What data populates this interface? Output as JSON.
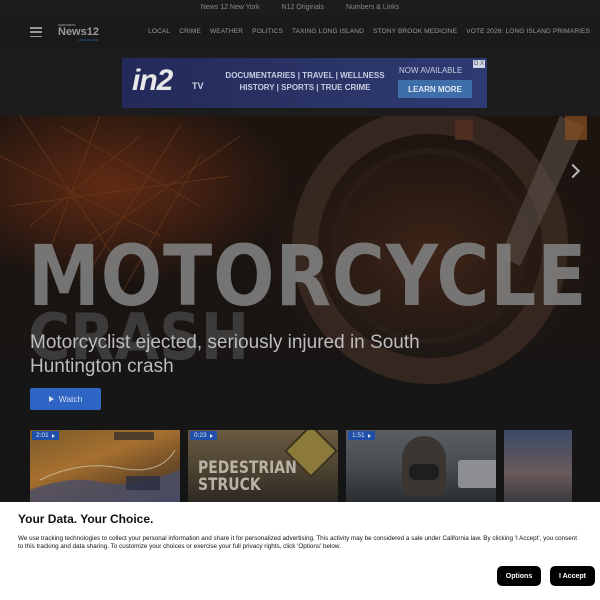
{
  "topbar": {
    "links": [
      "News 12 New York",
      "N12 Originals",
      "Numbers & Links"
    ]
  },
  "header": {
    "logo": {
      "prefix": "optimum.",
      "name": "News12",
      "sub": "LONG ISLAND"
    },
    "nav": [
      "LOCAL",
      "CRIME",
      "WEATHER",
      "POLITICS",
      "TAXING LONG ISLAND",
      "STONY BROOK MEDICINE",
      "VOTE 2026: LONG ISLAND PRIMARIES"
    ]
  },
  "ad": {
    "logo": "in2",
    "logo_suffix": "TV",
    "line1": "DOCUMENTARIES | TRAVEL | WELLNESS",
    "line2": "HISTORY | SPORTS | TRUE CRIME",
    "available": "NOW AVAILABLE",
    "cta": "LEARN MORE",
    "close": "D X"
  },
  "hero": {
    "graphic_word": "MOTORCYCLE",
    "graphic_word2": "CRASH",
    "headline": "Motorcyclist ejected, seriously injured in South Huntington crash",
    "watch_label": "Watch"
  },
  "thumbnails": [
    {
      "duration": "2:01",
      "overlay": ""
    },
    {
      "duration": "0:23",
      "overlay": "PEDESTRIAN STRUCK"
    },
    {
      "duration": "1:51",
      "overlay": ""
    },
    {
      "duration": "",
      "overlay": ""
    }
  ],
  "consent": {
    "title": "Your Data. Your Choice.",
    "body": "We use tracking technologies to collect your personal information and share it for personalized advertising. This activity may be considered a sale under California law. By clicking 'I Accept', you consent to this tracking and data sharing. To customize your choices or exercise your full privacy rights, click 'Options' below.",
    "options_label": "Options",
    "accept_label": "I Accept"
  }
}
